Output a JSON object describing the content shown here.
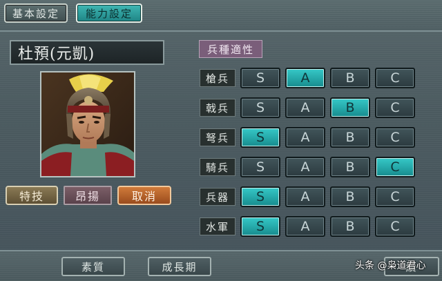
{
  "tabs": {
    "basic": "基本設定",
    "ability": "能力設定"
  },
  "officer": {
    "name": "杜預(元凱)"
  },
  "buttons": {
    "skill": "特技",
    "skill_value": "昂揚",
    "cancel": "取消"
  },
  "aptitude": {
    "title": "兵種適性",
    "grades": [
      "S",
      "A",
      "B",
      "C"
    ],
    "rows": [
      {
        "label": "槍兵",
        "selected": "A"
      },
      {
        "label": "戟兵",
        "selected": "B"
      },
      {
        "label": "弩兵",
        "selected": "S"
      },
      {
        "label": "騎兵",
        "selected": "C"
      },
      {
        "label": "兵器",
        "selected": "S"
      },
      {
        "label": "水軍",
        "selected": "S"
      }
    ]
  },
  "bottom": {
    "quality": "素質",
    "growth": "成長期",
    "right": "續"
  },
  "watermark": "头条 @枭道君心",
  "colors": {
    "selected": "#2fb8b8",
    "unselected": "#34464b",
    "cancel": "#c06a30",
    "skill": "#7a6a48"
  }
}
